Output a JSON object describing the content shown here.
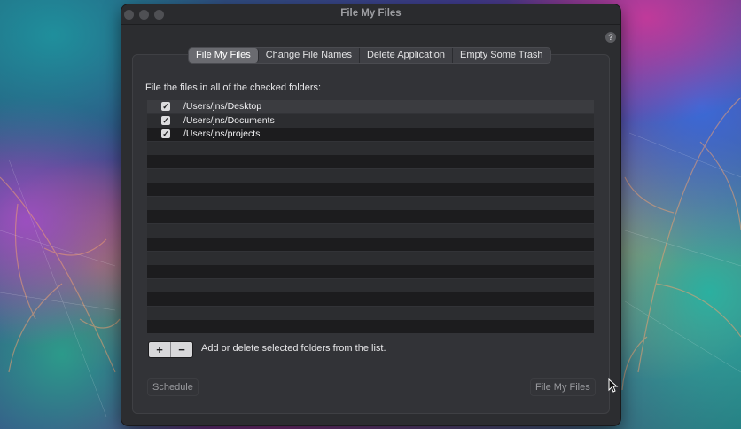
{
  "window": {
    "title": "File My Files"
  },
  "help": {
    "label": "?"
  },
  "tabs": [
    {
      "label": "File My Files",
      "active": true
    },
    {
      "label": "Change File Names",
      "active": false
    },
    {
      "label": "Delete Application",
      "active": false
    },
    {
      "label": "Empty Some Trash",
      "active": false
    }
  ],
  "instruction": "File the files in all of the checked folders:",
  "folders": [
    {
      "path": "/Users/jns/Desktop",
      "checked": true,
      "selected": true
    },
    {
      "path": "/Users/jns/Documents",
      "checked": true,
      "selected": false
    },
    {
      "path": "/Users/jns/projects",
      "checked": true,
      "selected": false
    }
  ],
  "list_controls": {
    "add_label": "+",
    "remove_label": "−",
    "hint": "Add or delete selected folders from the list."
  },
  "buttons": {
    "schedule": "Schedule",
    "file_my_files": "File My Files"
  },
  "colors": {
    "window_bg": "#2c2d30",
    "row_dark": "#1c1c1e",
    "row_selected": "#3b3c40",
    "tab_active": "#6a6b70"
  }
}
